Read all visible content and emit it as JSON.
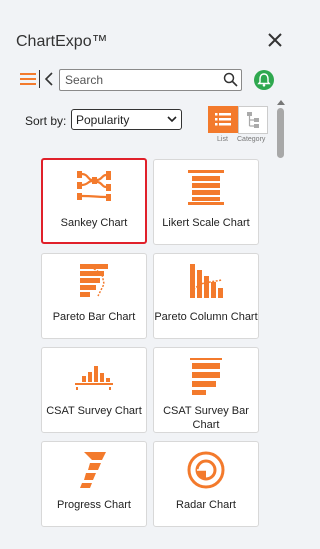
{
  "app": {
    "title": "ChartExpo™"
  },
  "search": {
    "placeholder": "Search",
    "value": ""
  },
  "sort": {
    "label": "Sort by:",
    "selected": "Popularity"
  },
  "views": {
    "list_label": "List",
    "category_label": "Category"
  },
  "colors": {
    "accent": "#f37a2c",
    "notify": "#2fa84f",
    "selected_border": "#e0202a"
  },
  "charts": [
    {
      "label": "Sankey Chart",
      "icon": "sankey-icon"
    },
    {
      "label": "Likert Scale Chart",
      "icon": "likert-scale-icon"
    },
    {
      "label": "Pareto Bar Chart",
      "icon": "pareto-bar-icon"
    },
    {
      "label": "Pareto Column Chart",
      "icon": "pareto-column-icon"
    },
    {
      "label": "CSAT Survey Chart",
      "icon": "csat-survey-icon"
    },
    {
      "label": "CSAT Survey Bar Chart",
      "icon": "csat-survey-bar-icon"
    },
    {
      "label": "Progress Chart",
      "icon": "progress-chart-icon"
    },
    {
      "label": "Radar Chart",
      "icon": "radar-chart-icon"
    }
  ]
}
